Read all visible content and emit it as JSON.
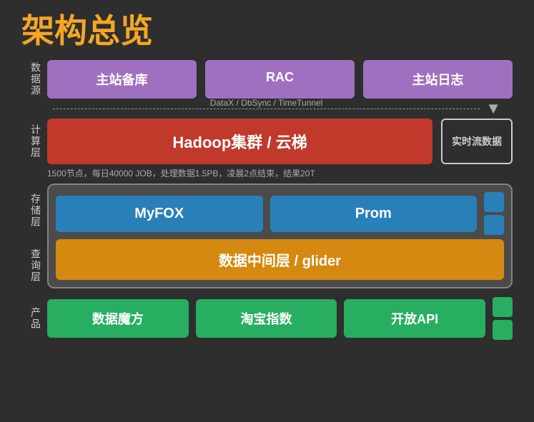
{
  "page": {
    "title": "架构总览",
    "background": "#2e2e2e"
  },
  "layers": {
    "data_source": {
      "label": "数据源",
      "boxes": [
        "主站备库",
        "RAC",
        "主站日志"
      ]
    },
    "arrow": {
      "text": "DataX / DbSync / TimeTunnel"
    },
    "compute": {
      "label": "计算层",
      "main_box": "Hadoop集群 / 云梯",
      "side_box": "实时流数据",
      "subtitle": "1500节点，每日40000 JOB，处理数据1.5PB，凌晨2点结束，结果20T"
    },
    "storage": {
      "label": "存储层",
      "boxes": [
        "MyFOX",
        "Prom"
      ]
    },
    "query": {
      "label": "查询层",
      "box": "数据中间层 / glider"
    },
    "product": {
      "label": "产品",
      "boxes": [
        "数据魔方",
        "淘宝指数",
        "开放API"
      ]
    }
  }
}
